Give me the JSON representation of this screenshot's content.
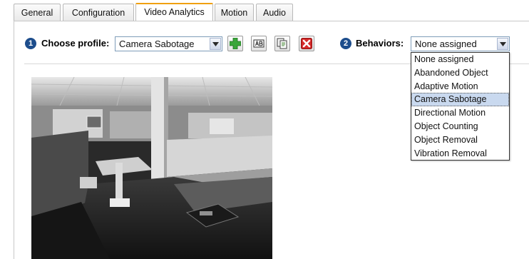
{
  "tabs": [
    {
      "label": "General",
      "active": false
    },
    {
      "label": "Configuration",
      "active": false
    },
    {
      "label": "Video Analytics",
      "active": true
    },
    {
      "label": "Motion",
      "active": false
    },
    {
      "label": "Audio",
      "active": false
    }
  ],
  "profile": {
    "step": "1",
    "label": "Choose profile:",
    "selected": "Camera Sabotage"
  },
  "toolbar": {
    "add_icon": "plus-icon",
    "rename_icon": "rename-field-icon",
    "copy_icon": "copy-icon",
    "delete_icon": "delete-x-icon"
  },
  "behaviors": {
    "step": "2",
    "label": "Behaviors:",
    "selected": "None assigned",
    "options": [
      "None assigned",
      "Abandoned Object",
      "Adaptive Motion",
      "Camera Sabotage",
      "Directional Motion",
      "Object Counting",
      "Object Removal",
      "Vibration Removal"
    ],
    "highlighted": "Camera Sabotage"
  },
  "colors": {
    "accent_tab": "#f0a010",
    "step_badge": "#1d4d8c",
    "add_green": "#3aa63a",
    "delete_red": "#d42a2a",
    "highlight": "#c9d9ef"
  }
}
